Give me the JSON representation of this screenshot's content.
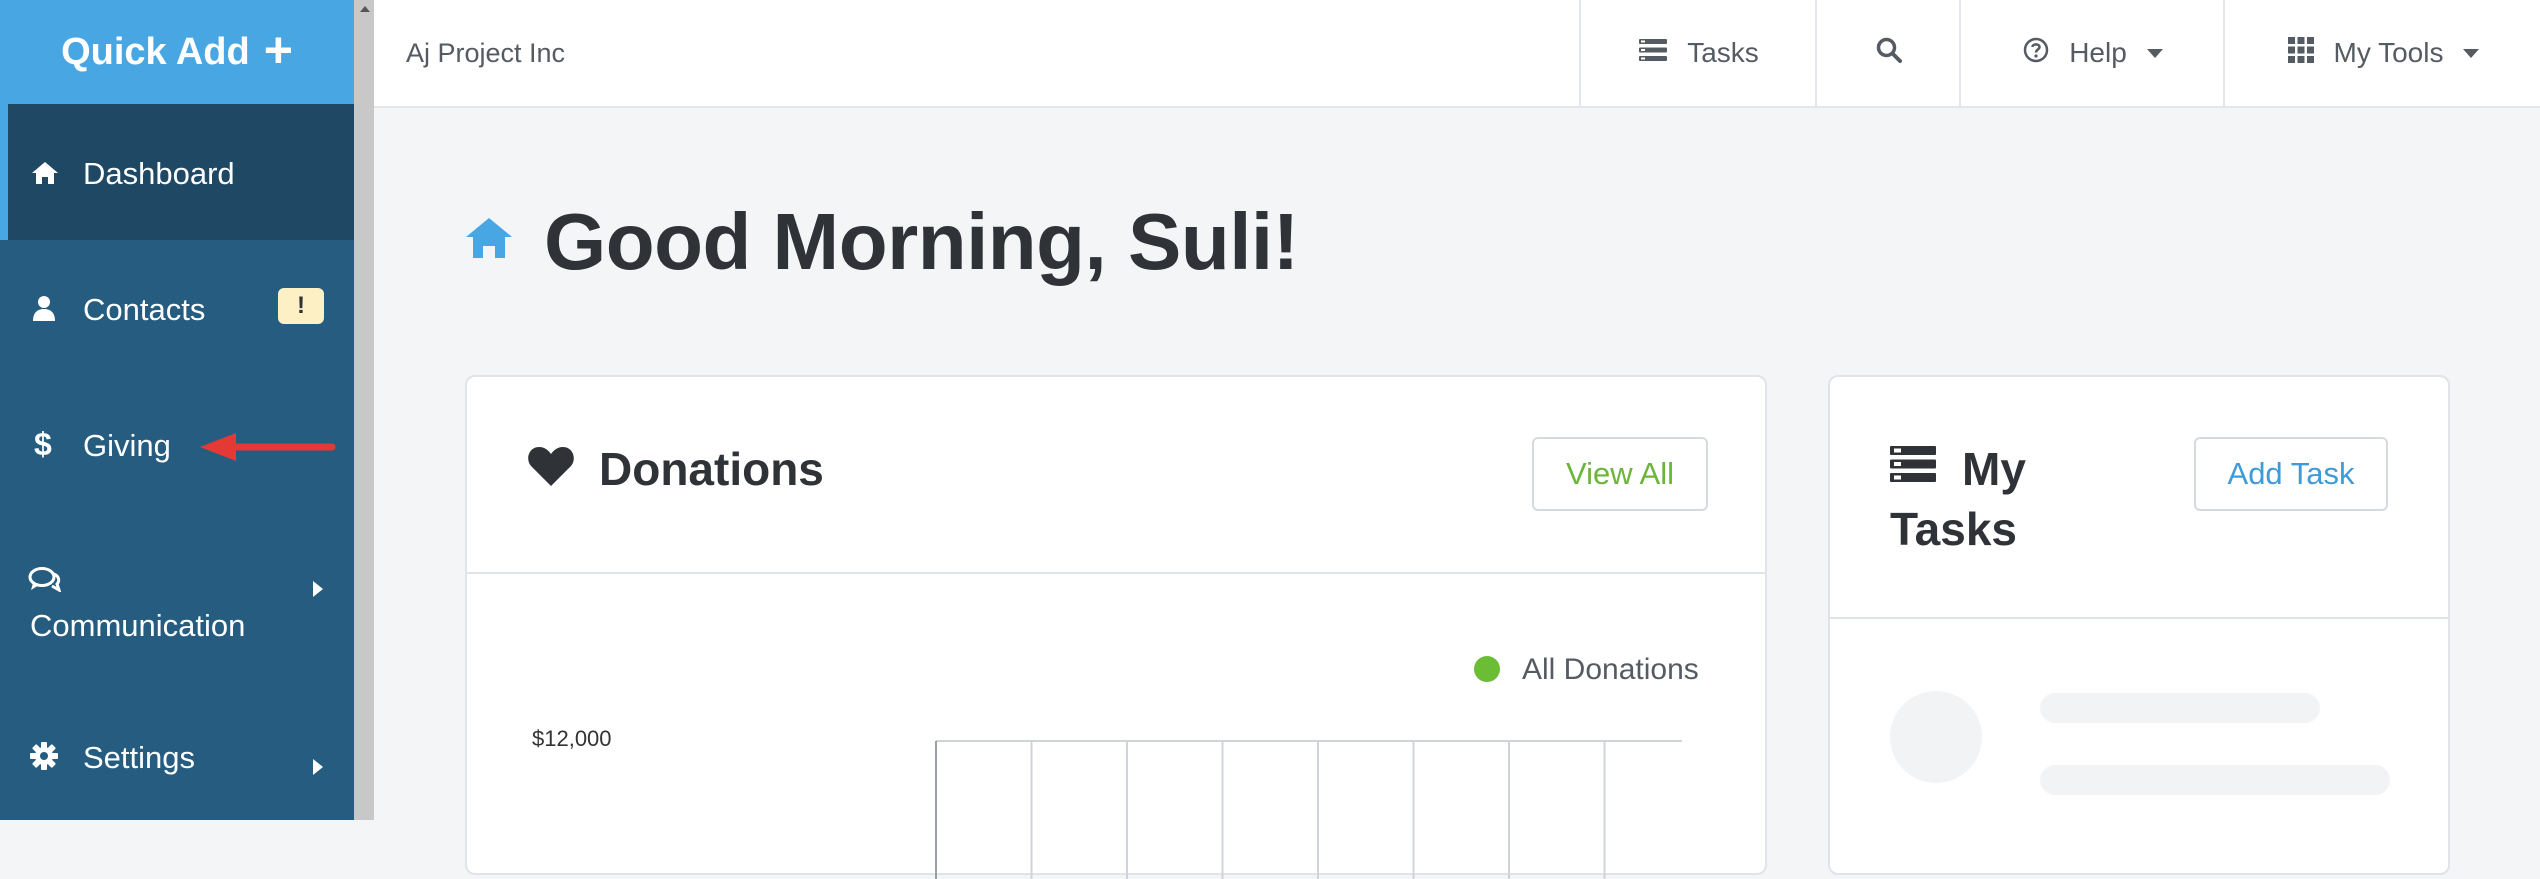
{
  "sidebar": {
    "quick_add_label": "Quick Add",
    "items": [
      {
        "label": "Dashboard",
        "icon": "home-icon",
        "active": true
      },
      {
        "label": "Contacts",
        "icon": "user-icon",
        "badge": "!"
      },
      {
        "label": "Giving",
        "icon": "dollar-icon"
      },
      {
        "label": "Communication",
        "icon": "chat-icon"
      },
      {
        "label": "Settings",
        "icon": "gear-icon"
      }
    ]
  },
  "topbar": {
    "org_name": "Aj Project Inc",
    "tasks_label": "Tasks",
    "help_label": "Help",
    "tools_label": "My Tools"
  },
  "main": {
    "greeting": "Good Morning, Suli!",
    "donations": {
      "title": "Donations",
      "view_all_label": "View All",
      "legend_label": "All Donations",
      "y_tick_top": "$12,000"
    },
    "tasks": {
      "title": "My Tasks",
      "add_task_label": "Add Task"
    }
  },
  "colors": {
    "sidebar": "#255c80",
    "sidebar_active": "#1f4865",
    "quick_add": "#48a6e3",
    "green": "#6cb53a",
    "blue_link": "#3d9bd9",
    "annotation_arrow": "#e53935"
  }
}
